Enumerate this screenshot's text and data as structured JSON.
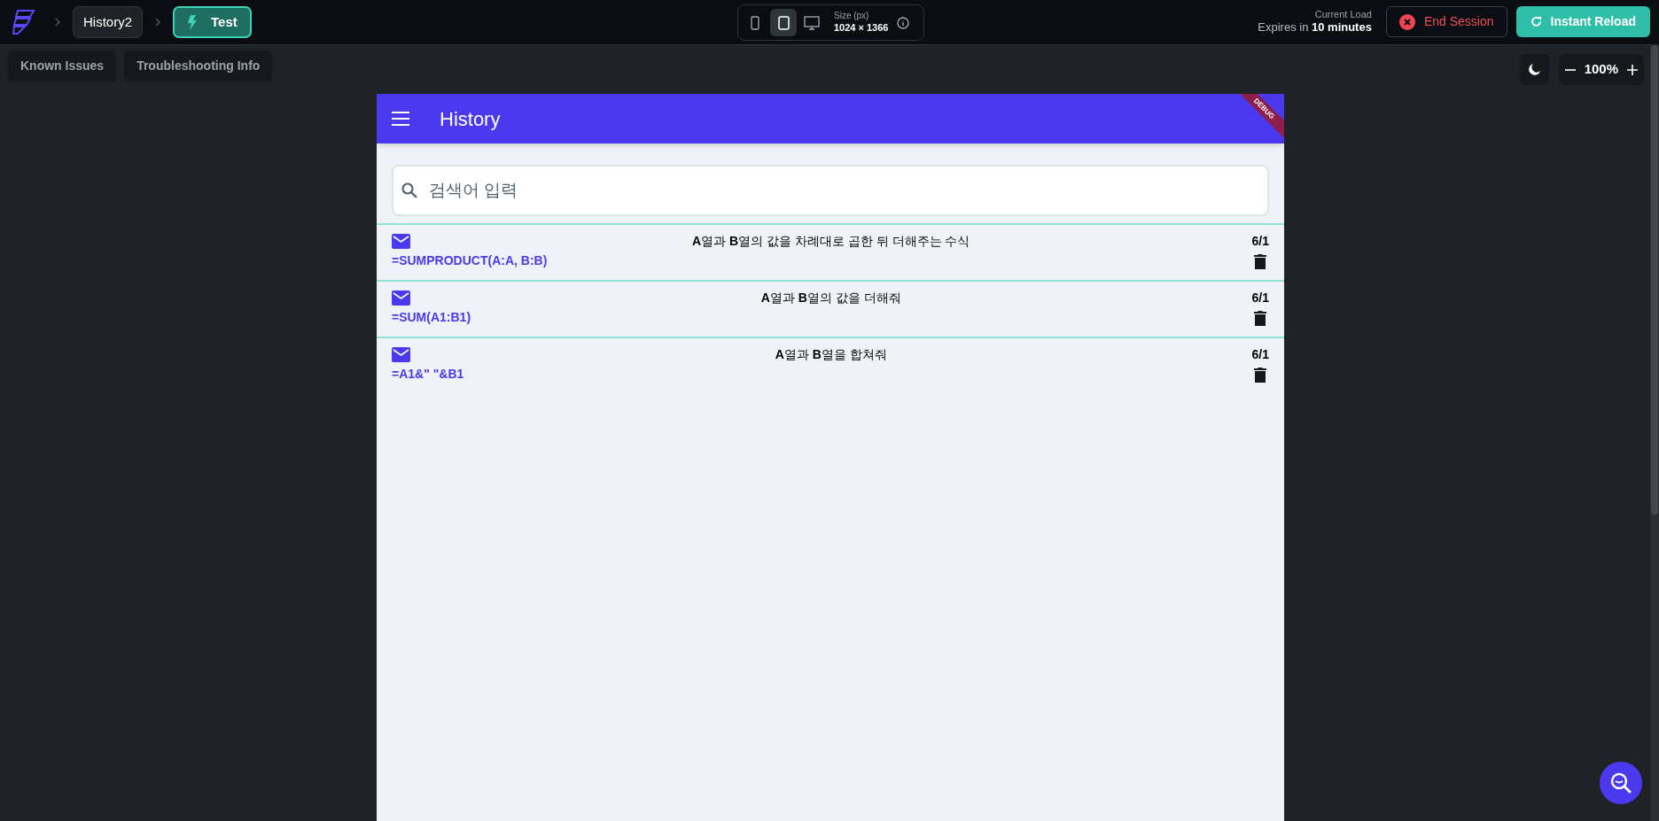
{
  "breadcrumb": {
    "project": "History2",
    "page": "Test"
  },
  "device_toolbar": {
    "devices": [
      {
        "kind": "phone",
        "selected": false
      },
      {
        "kind": "tablet",
        "selected": true
      },
      {
        "kind": "desktop",
        "selected": false
      }
    ],
    "size_label": "Size (px)",
    "size_value": "1024 × 1366"
  },
  "session": {
    "load_label": "Current Load",
    "expires": "Expires in **10 minutes**",
    "end_button": "End Session",
    "reload_button": "Instant Reload"
  },
  "toolbar": {
    "buttons": [
      "Known Issues",
      "Troubleshooting Info"
    ],
    "zoom": "100%"
  },
  "app": {
    "title": "History",
    "banner": "DEBUG",
    "search": {
      "placeholder": "검색어 입력"
    },
    "items": [
      {
        "question": "**A**열과 **B**열의 값을 차례대로 곱한 뒤 더해주는 수식",
        "formula": "=SUMPRODUCT(A:A, B:B)",
        "date": "6/1"
      },
      {
        "question": "**A**열과 **B**열의 값을 더해줘",
        "formula": "=SUM(A1:B1)",
        "date": "6/1"
      },
      {
        "question": "**A**열과 **B**열을 합쳐줘",
        "formula": "=A1&\" \"&B1",
        "date": "6/1"
      }
    ]
  }
}
